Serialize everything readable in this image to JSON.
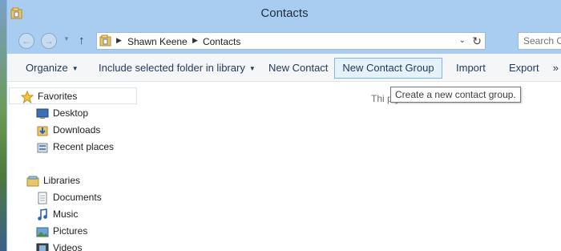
{
  "window": {
    "title": "Contacts"
  },
  "addressbar": {
    "crumbs": [
      "Shawn Keene",
      "Contacts"
    ]
  },
  "search": {
    "placeholder": "Search C"
  },
  "toolbar": {
    "organize": "Organize",
    "include": "Include selected folder in library",
    "new_contact": "New Contact",
    "new_contact_group": "New Contact Group",
    "import": "Import",
    "export": "Export",
    "more": "»"
  },
  "tooltip": {
    "text": "Create a new contact group."
  },
  "navpane": {
    "favorites": "Favorites",
    "favorites_items": [
      "Desktop",
      "Downloads",
      "Recent places"
    ],
    "libraries": "Libraries",
    "libraries_items": [
      "Documents",
      "Music",
      "Pictures",
      "Videos"
    ]
  },
  "content": {
    "empty_message_fragment": "Thi                      pty."
  },
  "colors": {
    "titlebar": "#a9cdf0",
    "toolbar_bg": "#f5f6f7",
    "hover_bg": "#e5f1fb",
    "hover_border": "#7eb4ea"
  }
}
